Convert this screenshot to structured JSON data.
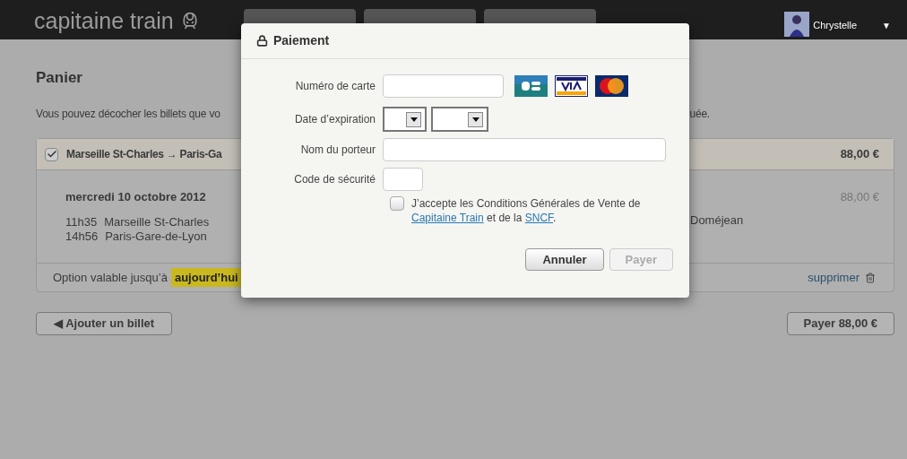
{
  "header": {
    "logo": "capitaine train",
    "user": {
      "name": "Chrystelle",
      "menu_arrow": "▼"
    }
  },
  "page": {
    "title": "Panier",
    "intro_left": "Vous pouvez décocher les billets que vo",
    "intro_right": "uée."
  },
  "ticket": {
    "checked": true,
    "route": "Marseille St-Charles → Paris-Ga",
    "price": "88,00 €",
    "date": "mercredi 10 octobre 2012",
    "stops": [
      {
        "time": "11h35",
        "station": "Marseille St-Charles"
      },
      {
        "time": "14h56",
        "station": "Paris-Gare-de-Lyon"
      }
    ],
    "passenger": "Doméjean",
    "passenger_price": "88,00 €",
    "option_label": "Option valable jusqu’à",
    "option_deadline": "aujourd’hui",
    "delete_link": "supprimer"
  },
  "add_button": "◀ Ajouter un billet",
  "pay_button": "Payer 88,00 €",
  "dialog": {
    "title": "Paiement",
    "fields": [
      {
        "kind": "card",
        "label": "Numéro de carte"
      },
      {
        "kind": "expiry",
        "label": "Date d’expiration"
      },
      {
        "kind": "name",
        "label": "Nom du porteur"
      },
      {
        "kind": "cvv",
        "label": "Code de sécurité"
      }
    ],
    "terms": {
      "checked": false,
      "parts": [
        {
          "kind": "text",
          "text": "J’accepte les Conditions Générales de Vente de "
        },
        {
          "kind": "link",
          "text": "Capitaine Train"
        },
        {
          "kind": "text",
          "text": " et de la "
        },
        {
          "kind": "link",
          "text": "SNCF"
        },
        {
          "kind": "text",
          "text": "."
        }
      ]
    },
    "buttons": [
      {
        "label": "Annuler",
        "disabled": false
      },
      {
        "label": "Payer",
        "disabled": true
      }
    ]
  }
}
